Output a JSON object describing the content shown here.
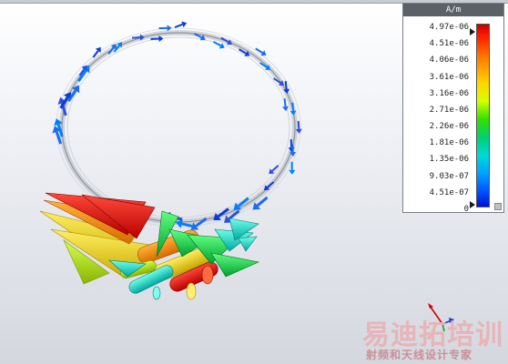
{
  "legend": {
    "unit": "A/m",
    "ticks": [
      "4.97e-06",
      "4.51e-06",
      "4.06e-06",
      "3.61e-06",
      "3.16e-06",
      "2.71e-06",
      "2.26e-06",
      "1.81e-06",
      "1.35e-06",
      "9.03e-07",
      "4.51e-07",
      "0"
    ],
    "max_color": "#c80000",
    "min_color": "#0010d0"
  },
  "scene": {
    "description_type": "3D magnetic field vector plot around a ring",
    "ring_color": "#a8acb4"
  },
  "watermark": {
    "title": "易迪拓培训",
    "subtitle": "射频和天线设计专家"
  }
}
